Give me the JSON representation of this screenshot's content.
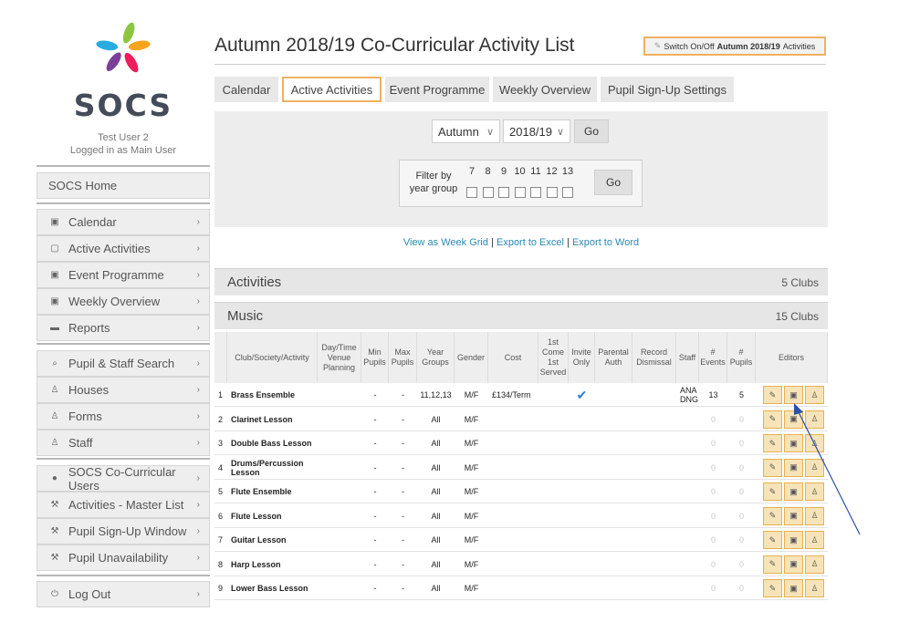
{
  "sidebar": {
    "logo_text": "SOCS",
    "user_name": "Test User 2",
    "user_status": "Logged in as Main User",
    "home_label": "SOCS Home",
    "group1": [
      {
        "label": "Calendar",
        "icon": "calendar-icon",
        "glyph": "▣"
      },
      {
        "label": "Active Activities",
        "icon": "clipboard-icon",
        "glyph": "▢"
      },
      {
        "label": "Event Programme",
        "icon": "calendar-icon",
        "glyph": "▣"
      },
      {
        "label": "Weekly Overview",
        "icon": "calendar-icon",
        "glyph": "▣"
      },
      {
        "label": "Reports",
        "icon": "folder-icon",
        "glyph": "▬"
      }
    ],
    "group2": [
      {
        "label": "Pupil & Staff Search",
        "icon": "search-icon",
        "glyph": "⌕"
      },
      {
        "label": "Houses",
        "icon": "user-icon",
        "glyph": "♙"
      },
      {
        "label": "Forms",
        "icon": "user-icon",
        "glyph": "♙"
      },
      {
        "label": "Staff",
        "icon": "user-icon",
        "glyph": "♙"
      }
    ],
    "group3": [
      {
        "label": "SOCS Co-Curricular Users",
        "icon": "lock-icon",
        "glyph": "●"
      },
      {
        "label": "Activities - Master List",
        "icon": "wrench-icon",
        "glyph": "⚒"
      },
      {
        "label": "Pupil Sign-Up Window",
        "icon": "wrench-icon",
        "glyph": "⚒"
      },
      {
        "label": "Pupil Unavailability",
        "icon": "wrench-icon",
        "glyph": "⚒"
      }
    ],
    "logout_label": "Log Out"
  },
  "header": {
    "title": "Autumn 2018/19 Co-Curricular Activity List",
    "switch_prefix": "Switch On/Off",
    "switch_bold": "Autumn 2018/19",
    "switch_suffix": "Activities"
  },
  "tabs": [
    "Calendar",
    "Active Activities",
    "Event Programme",
    "Weekly Overview",
    "Pupil Sign-Up Settings"
  ],
  "filters": {
    "term": "Autumn",
    "year": "2018/19",
    "go_label": "Go",
    "filter_label": "Filter by year group",
    "year_groups": [
      "7",
      "8",
      "9",
      "10",
      "11",
      "12",
      "13"
    ],
    "go2_label": "Go"
  },
  "links": {
    "week_grid": "View as Week Grid",
    "excel": "Export to Excel",
    "word": "Export to Word"
  },
  "sections": {
    "activities_title": "Activities",
    "activities_count": "5 Clubs",
    "music_title": "Music",
    "music_count": "15 Clubs"
  },
  "table": {
    "headers": [
      "",
      "Club/Society/Activity",
      "Day/Time Venue Planning",
      "Min Pupils",
      "Max Pupils",
      "Year Groups",
      "Gender",
      "Cost",
      "1st Come 1st Served",
      "Invite Only",
      "Parental Auth",
      "Record Dismissal",
      "Staff",
      "# Events",
      "# Pupils",
      "Editors"
    ],
    "rows": [
      {
        "n": "1",
        "name": "Brass Ensemble",
        "min": "-",
        "max": "-",
        "years": "11,12,13",
        "gender": "M/F",
        "cost": "£134/Term",
        "invite": "✔",
        "staff": "ANA DNG",
        "events": "13",
        "pupils": "5",
        "active": true
      },
      {
        "n": "2",
        "name": "Clarinet Lesson",
        "min": "-",
        "max": "-",
        "years": "All",
        "gender": "M/F",
        "cost": "",
        "invite": "",
        "staff": "",
        "events": "0",
        "pupils": "0",
        "active": false
      },
      {
        "n": "3",
        "name": "Double Bass Lesson",
        "min": "-",
        "max": "-",
        "years": "All",
        "gender": "M/F",
        "cost": "",
        "invite": "",
        "staff": "",
        "events": "0",
        "pupils": "0",
        "active": false
      },
      {
        "n": "4",
        "name": "Drums/Percussion Lesson",
        "min": "-",
        "max": "-",
        "years": "All",
        "gender": "M/F",
        "cost": "",
        "invite": "",
        "staff": "",
        "events": "0",
        "pupils": "0",
        "active": false
      },
      {
        "n": "5",
        "name": "Flute Ensemble",
        "min": "-",
        "max": "-",
        "years": "All",
        "gender": "M/F",
        "cost": "",
        "invite": "",
        "staff": "",
        "events": "0",
        "pupils": "0",
        "active": false
      },
      {
        "n": "6",
        "name": "Flute Lesson",
        "min": "-",
        "max": "-",
        "years": "All",
        "gender": "M/F",
        "cost": "",
        "invite": "",
        "staff": "",
        "events": "0",
        "pupils": "0",
        "active": false
      },
      {
        "n": "7",
        "name": "Guitar Lesson",
        "min": "-",
        "max": "-",
        "years": "All",
        "gender": "M/F",
        "cost": "",
        "invite": "",
        "staff": "",
        "events": "0",
        "pupils": "0",
        "active": false
      },
      {
        "n": "8",
        "name": "Harp Lesson",
        "min": "-",
        "max": "-",
        "years": "All",
        "gender": "M/F",
        "cost": "",
        "invite": "",
        "staff": "",
        "events": "0",
        "pupils": "0",
        "active": false
      },
      {
        "n": "9",
        "name": "Lower Bass Lesson",
        "min": "-",
        "max": "-",
        "years": "All",
        "gender": "M/F",
        "cost": "",
        "invite": "",
        "staff": "",
        "events": "0",
        "pupils": "0",
        "active": false
      }
    ]
  },
  "colors": {
    "accent": "#f0b060",
    "link": "#2a8ab0",
    "editor_bg": "#f6e3b8",
    "annotation_arrow": "#2c4fa8"
  }
}
